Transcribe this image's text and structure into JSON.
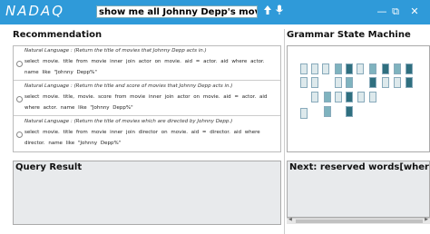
{
  "app": {
    "logo": "NADAQ"
  },
  "search": {
    "value": "show me all Johnny Depp's movies."
  },
  "window": {
    "minimize": "—",
    "restore": "⧉",
    "close": "✕"
  },
  "sections": {
    "recommendation": "Recommendation",
    "grammar": "Grammar State Machine",
    "query_result": "Query Result",
    "next": "Next: reserved words[where inner"
  },
  "recommendations": [
    {
      "natural_language": "Natural Language : (Return the title of movies that Johnny Depp acts in.)",
      "sql": "select movie. title from movie inner join actor on movie. aid = actor. aid where actor. name like \"Johnny Depp%\""
    },
    {
      "natural_language": "Natural Language : (Return the title and score of movies that Johnny Depp acts in.)",
      "sql": "select movie. title, movie. score from movie inner join actor on movie. aid = actor. aid where actor. name like \"Johnny Depp%\""
    },
    {
      "natural_language": "Natural Language : (Return the title of movies which are directed by Johnny Depp.)",
      "sql": "select movie. title from movie inner join director on movie. aid = director. aid where director. name like \"Johnny Depp%\""
    }
  ],
  "colors": {
    "titlebar": "#2f9ad9",
    "node_dark": "#2f6f7f",
    "node_mid": "#7fb3bf",
    "node_light": "#dde9ec"
  },
  "icons": [
    "upload-icon",
    "microphone-icon",
    "minimize-icon",
    "restore-icon",
    "close-icon"
  ]
}
